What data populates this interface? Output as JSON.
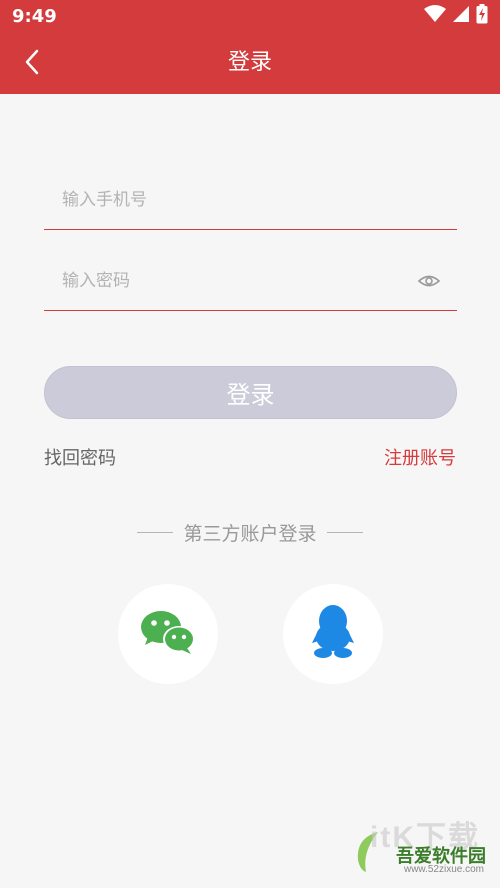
{
  "status_bar": {
    "time": "9:49",
    "icons": [
      "wifi-icon",
      "cellular-signal-icon",
      "battery-charging-icon"
    ]
  },
  "header": {
    "title": "登录",
    "back_icon": "chevron-left-icon"
  },
  "form": {
    "phone": {
      "placeholder": "输入手机号",
      "value": ""
    },
    "password": {
      "placeholder": "输入密码",
      "value": "",
      "toggle_icon": "eye-icon"
    },
    "login_button": "登录"
  },
  "links": {
    "forgot_password": "找回密码",
    "register": "注册账号"
  },
  "third_party": {
    "label": "第三方账户登录",
    "providers": [
      {
        "name": "wechat",
        "icon": "wechat-icon",
        "color": "#4caf50"
      },
      {
        "name": "qq",
        "icon": "qq-icon",
        "color": "#1e88e5"
      }
    ]
  },
  "watermark": {
    "logo_text": "itK下载",
    "site_name": "吾爱软件园",
    "url": "www.52zixue.com"
  },
  "colors": {
    "primary": "#d33b3c",
    "button_disabled": "#cbcbd9",
    "background": "#f6f6f6"
  }
}
